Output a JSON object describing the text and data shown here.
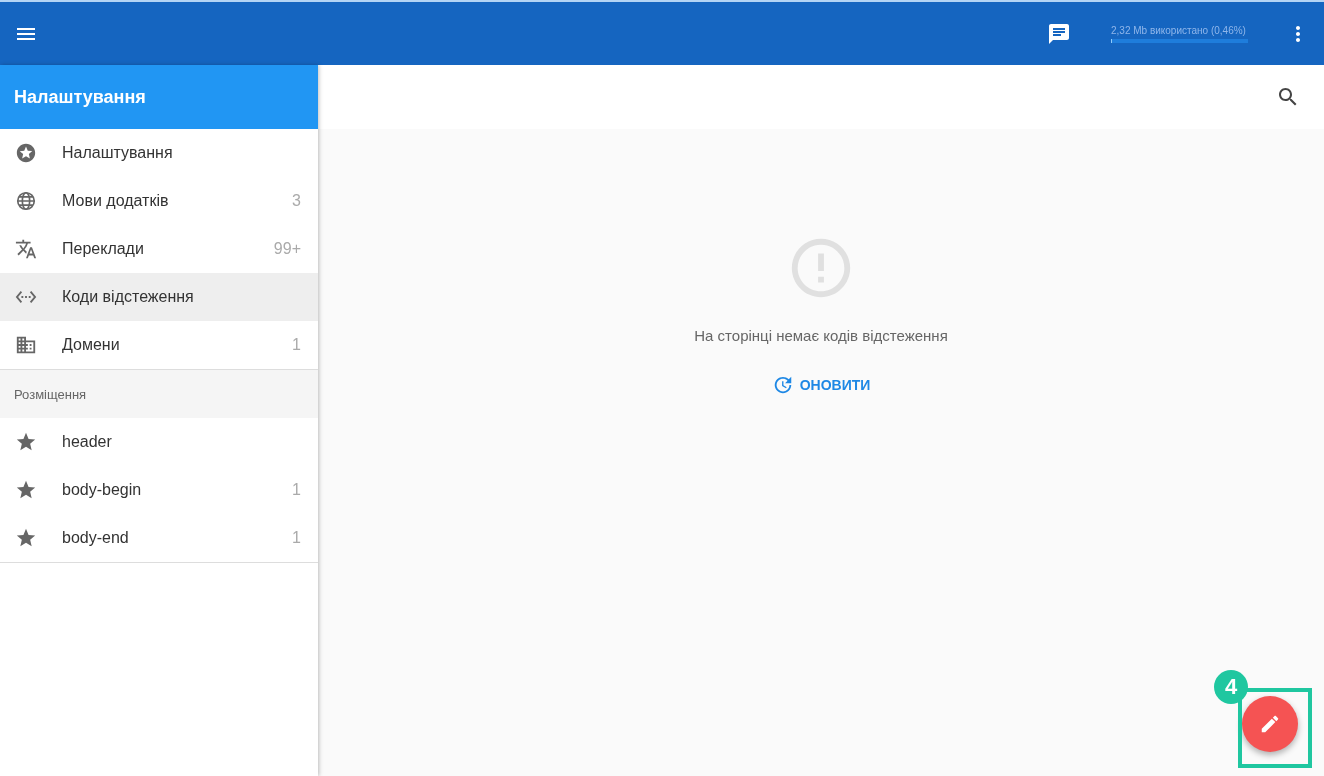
{
  "top_bar": {
    "storage": {
      "text": "2,32 Mb використано (0,46%)",
      "level": 0.0046
    }
  },
  "sidebar": {
    "title": "Налаштування",
    "items": [
      {
        "label": "Налаштування",
        "selected": false
      },
      {
        "label": "Мови додатків",
        "count": "3",
        "selected": false
      },
      {
        "label": "Переклади",
        "count": "99+",
        "selected": false
      },
      {
        "label": "Коди відстеження",
        "selected": true
      },
      {
        "label": "Домени",
        "count": "1",
        "selected": false
      }
    ],
    "section": {
      "title": "Розміщення",
      "items": [
        {
          "label": "header",
          "selected": false
        },
        {
          "label": "body-begin",
          "count": "1",
          "selected": false
        },
        {
          "label": "body-end",
          "count": "1",
          "selected": false
        }
      ]
    }
  },
  "content": {
    "empty_message": "На сторінці немає кодів відстеження",
    "refresh_button": "ОНОВИТИ"
  },
  "annotation": {
    "number": "4"
  }
}
